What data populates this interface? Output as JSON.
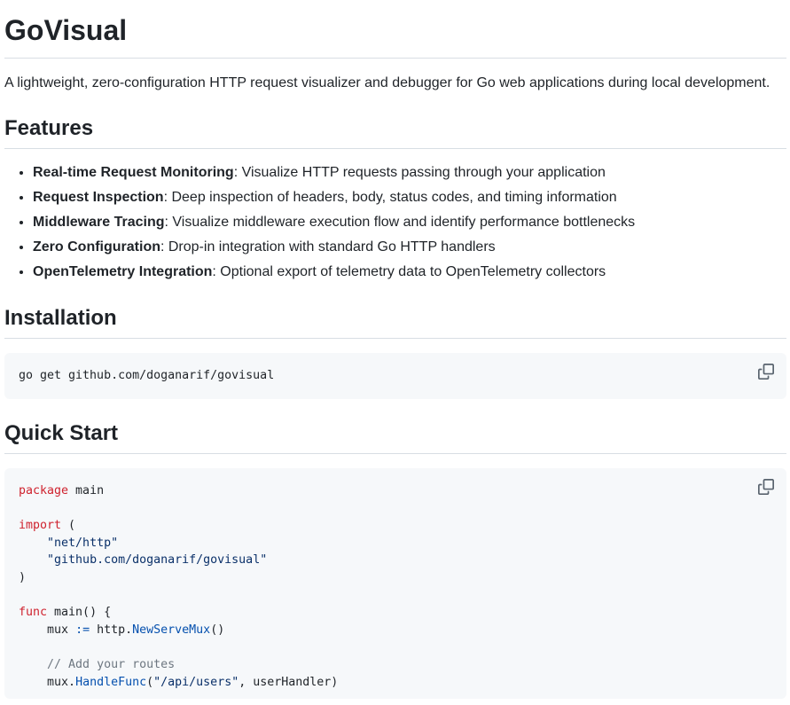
{
  "title": "GoVisual",
  "intro": "A lightweight, zero-configuration HTTP request visualizer and debugger for Go web applications during local development.",
  "features": {
    "heading": "Features",
    "items": [
      {
        "name": "Real-time Request Monitoring",
        "desc": ": Visualize HTTP requests passing through your application"
      },
      {
        "name": "Request Inspection",
        "desc": ": Deep inspection of headers, body, status codes, and timing information"
      },
      {
        "name": "Middleware Tracing",
        "desc": ": Visualize middleware execution flow and identify performance bottlenecks"
      },
      {
        "name": "Zero Configuration",
        "desc": ": Drop-in integration with standard Go HTTP handlers"
      },
      {
        "name": "OpenTelemetry Integration",
        "desc": ": Optional export of telemetry data to OpenTelemetry collectors"
      }
    ]
  },
  "installation": {
    "heading": "Installation",
    "command": "go get github.com/doganarif/govisual"
  },
  "quickstart": {
    "heading": "Quick Start",
    "code": {
      "kw_package": "package",
      "pkg_name": " main",
      "kw_import": "import",
      "import_open": " (",
      "imp1": "\"net/http\"",
      "imp2": "\"github.com/doganarif/govisual\"",
      "import_close": ")",
      "kw_func": "func",
      "func_sig": " main() {",
      "mux_var": "mux ",
      "assign_op": ":=",
      "http_pkg": " http.",
      "new_serve_mux": "NewServeMux",
      "call_parens": "()",
      "comment": "// Add your routes",
      "mux_dot": "mux.",
      "handle_func": "HandleFunc",
      "paren_open": "(",
      "route": "\"/api/users\"",
      "handler_arg": ", userHandler)"
    }
  },
  "icons": {
    "copy": "copy-icon"
  },
  "colors": {
    "keyword": "#cf222e",
    "string": "#0a3069",
    "function": "#0550ae",
    "comment": "#6e7781",
    "code_bg": "#f6f8fa"
  }
}
